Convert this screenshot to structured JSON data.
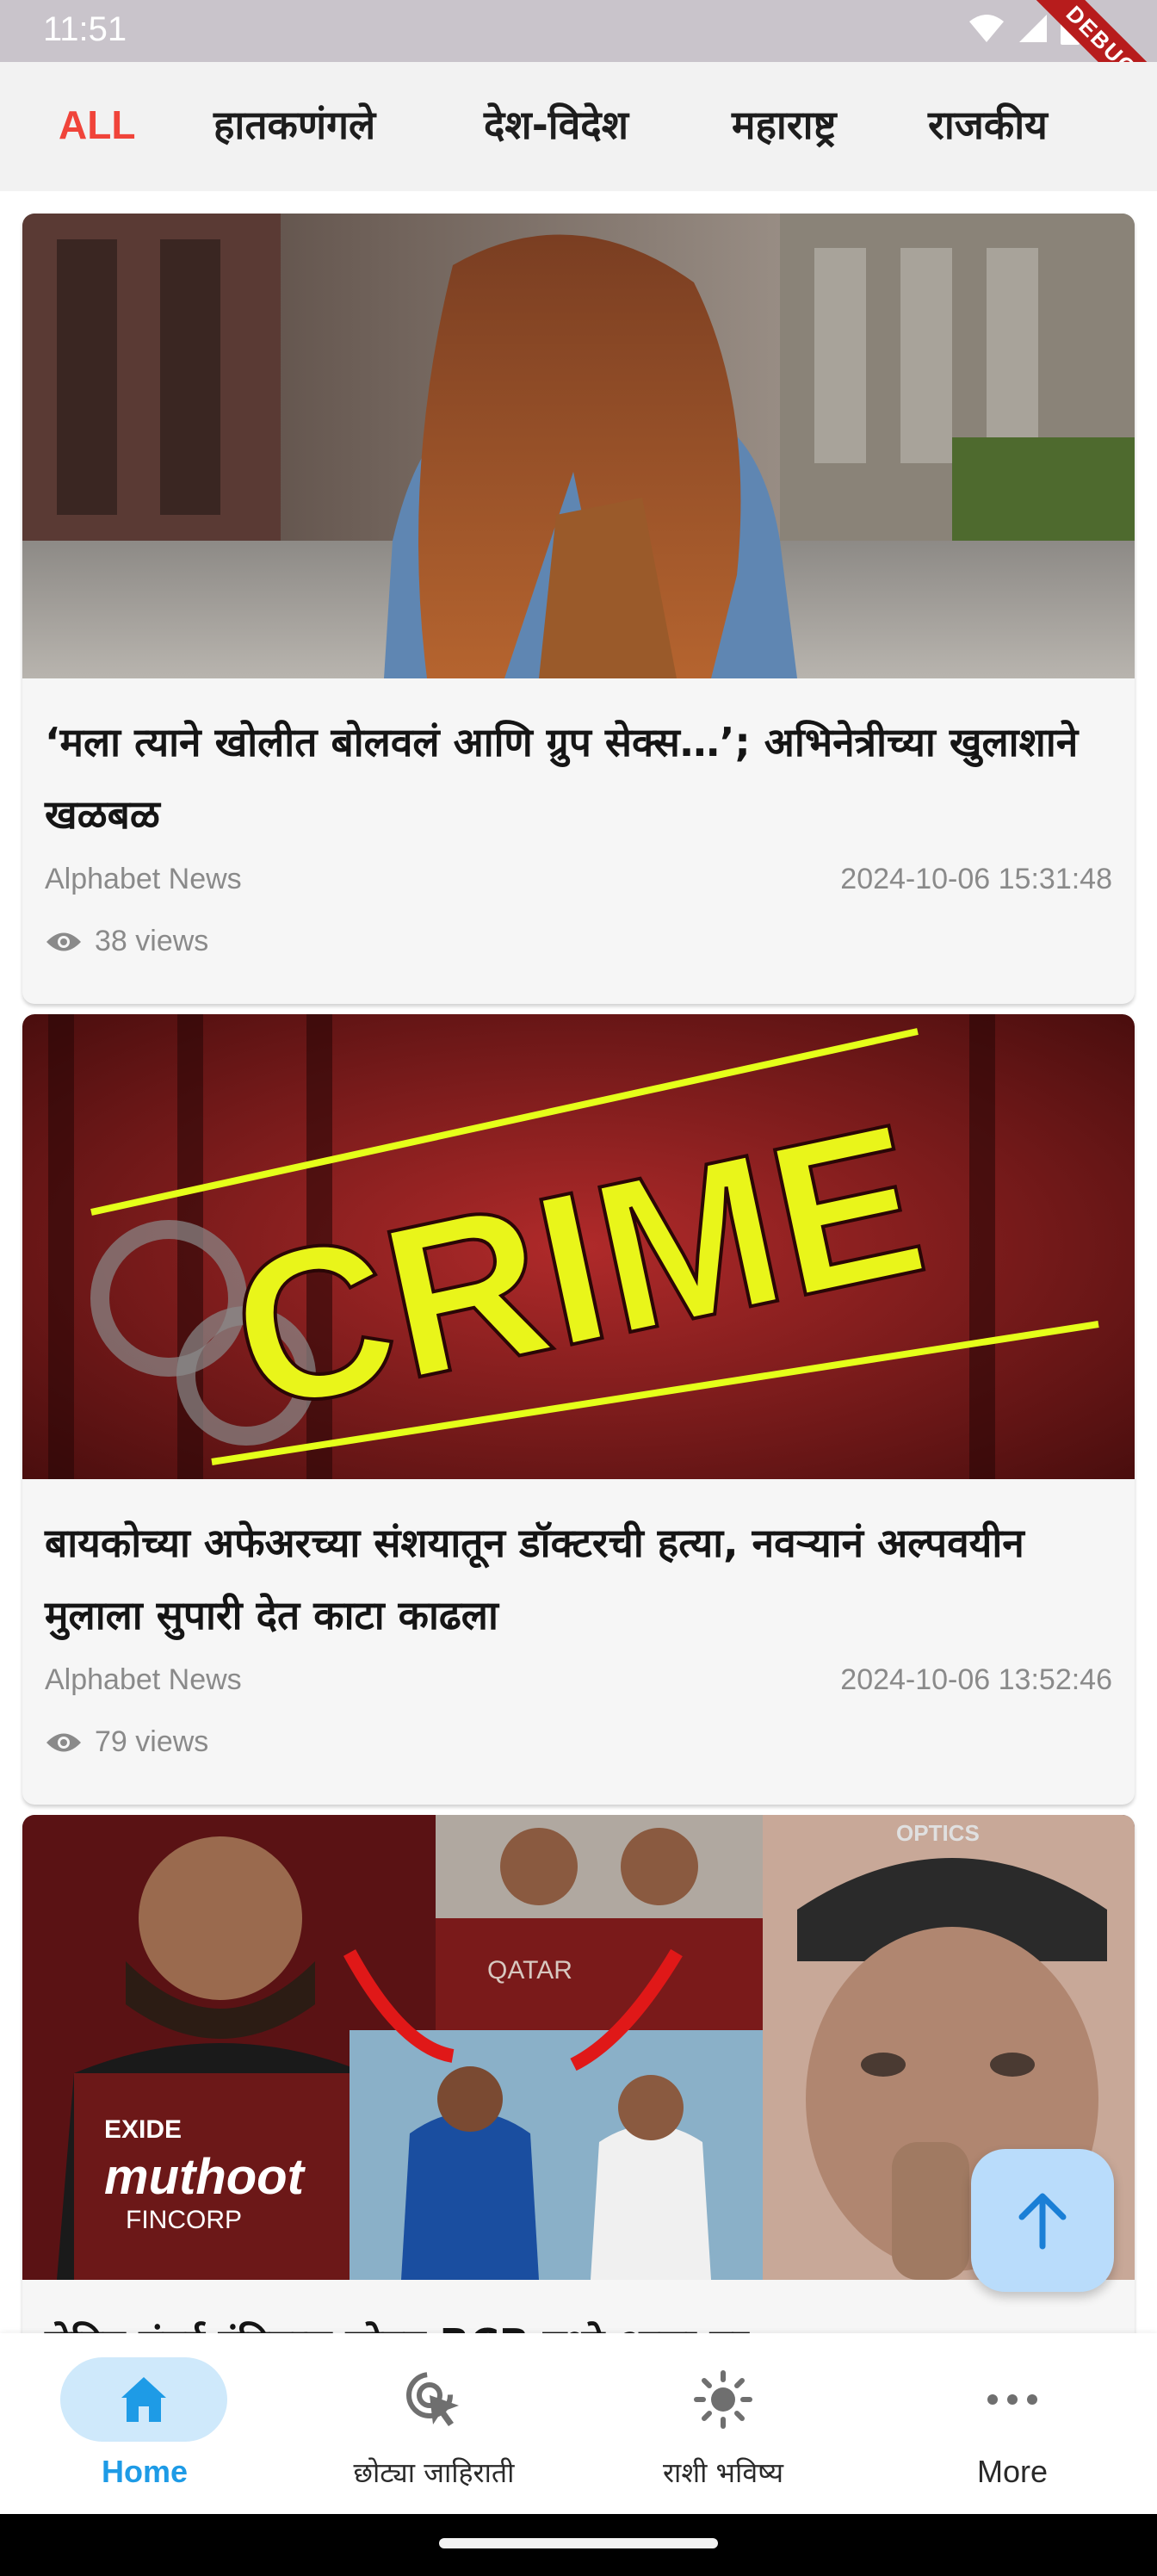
{
  "status_bar": {
    "time": "11:51",
    "debug_label": "DEBUG",
    "icons": [
      "wifi-icon",
      "signal-icon",
      "battery-icon"
    ]
  },
  "category_tabs": {
    "items": [
      {
        "label": "ALL",
        "active": true
      },
      {
        "label": "हातकणंगले",
        "active": false
      },
      {
        "label": "देश-विदेश",
        "active": false
      },
      {
        "label": "महाराष्ट्र",
        "active": false
      },
      {
        "label": "राजकीय",
        "active": false
      }
    ],
    "active_color": "#f0443a"
  },
  "articles": [
    {
      "title": "‘मला त्याने खोलीत बोलवलं आणि ग्रुप सेक्स…’; अभिनेत्रीच्या खुलाशाने खळबळ",
      "source": "Alphabet News",
      "date": "2024-10-06 15:31:48",
      "views": "38 views",
      "image": "woman-walking-street-photo"
    },
    {
      "title": "बायकोच्या अफेअरच्या संशयातून डॉक्टरची हत्या, नवऱ्यानं अल्पवयीन मुलाला सुपारी देत काटा काढला",
      "source": "Alphabet News",
      "date": "2024-10-06 13:52:46",
      "views": "79 views",
      "image": "crime-banner",
      "image_text": "CRIME"
    },
    {
      "title": "रोहित मुंबई इंडियन्स सोडून RCB मध्ये आला तर…",
      "image": "cricket-collage",
      "image_text": {
        "jersey_sponsor": "muthoot",
        "jersey_sub": "FINCORP",
        "exide": "EXIDE",
        "qatar": "QATAR",
        "optics": "OPTICS"
      }
    }
  ],
  "fab": {
    "icon": "arrow-up-icon"
  },
  "bottom_nav": {
    "items": [
      {
        "label": "Home",
        "icon": "home-icon",
        "active": true
      },
      {
        "label": "छोट्या जाहिराती",
        "icon": "cursor-click-icon",
        "active": false
      },
      {
        "label": "राशी भविष्य",
        "icon": "sun-icon",
        "active": false
      },
      {
        "label": "More",
        "icon": "more-dots-icon",
        "active": false
      }
    ],
    "active_color": "#1e9be6"
  }
}
